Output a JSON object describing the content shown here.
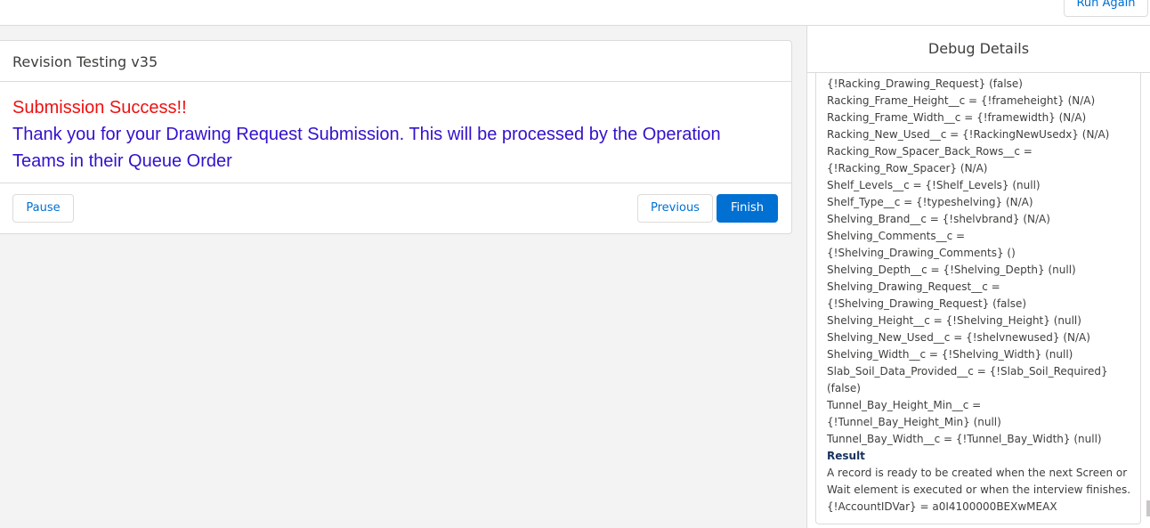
{
  "topbar": {
    "run_again_label": "Run Again"
  },
  "flow": {
    "title": "Revision Testing v35",
    "success_message": "Submission Success!!",
    "thanks_message": "Thank you for your Drawing Request Submission. This will be processed by the Operation Teams in their Queue Order",
    "buttons": {
      "pause": "Pause",
      "previous": "Previous",
      "finish": "Finish"
    }
  },
  "debug": {
    "title": "Debug Details",
    "lines": [
      "{!Racking_Drawing_Request} (false)",
      "Racking_Frame_Height__c = {!frameheight} (N/A)",
      "Racking_Frame_Width__c = {!framewidth} (N/A)",
      "Racking_New_Used__c = {!RackingNewUsedx} (N/A)",
      "Racking_Row_Spacer_Back_Rows__c =",
      "{!Racking_Row_Spacer} (N/A)",
      "Shelf_Levels__c = {!Shelf_Levels} (null)",
      "Shelf_Type__c = {!typeshelving} (N/A)",
      "Shelving_Brand__c = {!shelvbrand} (N/A)",
      "Shelving_Comments__c =",
      "{!Shelving_Drawing_Comments} ()",
      "Shelving_Depth__c = {!Shelving_Depth} (null)",
      "Shelving_Drawing_Request__c =",
      "{!Shelving_Drawing_Request} (false)",
      "Shelving_Height__c = {!Shelving_Height} (null)",
      "Shelving_New_Used__c = {!shelvnewused} (N/A)",
      "Shelving_Width__c = {!Shelving_Width} (null)",
      "Slab_Soil_Data_Provided__c = {!Slab_Soil_Required}",
      "(false)",
      "Tunnel_Bay_Height_Min__c =",
      "{!Tunnel_Bay_Height_Min} (null)",
      "Tunnel_Bay_Width__c = {!Tunnel_Bay_Width} (null)"
    ],
    "result_heading": "Result",
    "result_lines": [
      "A record is ready to be created when the next Screen or",
      "Wait element is executed or when the interview finishes.",
      "{!AccountIDVar} = a0I4100000BEXwMEAX"
    ]
  }
}
